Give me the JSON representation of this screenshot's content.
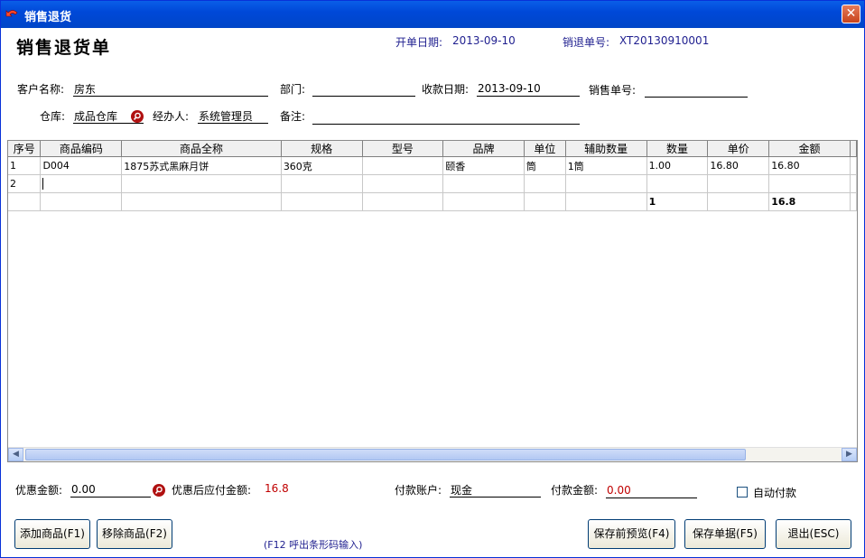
{
  "window": {
    "title": "销售退货",
    "close_glyph": "✕",
    "icon": "return-arrow-icon"
  },
  "header": {
    "form_title": "销售退货单",
    "open_date_label": "开单日期:",
    "open_date_value": "2013-09-10",
    "return_no_label": "销退单号:",
    "return_no_value": "XT20130910001"
  },
  "form": {
    "customer_label": "客户名称:",
    "customer_value": "房东",
    "dept_label": "部门:",
    "dept_value": "",
    "collect_date_label": "收款日期:",
    "collect_date_value": "2013-09-10",
    "sales_no_label": "销售单号:",
    "sales_no_value": "",
    "warehouse_label": "仓库:",
    "warehouse_value": "成品仓库",
    "handler_label": "经办人:",
    "handler_value": "系统管理员",
    "remark_label": "备注:",
    "remark_value": ""
  },
  "grid": {
    "columns": [
      "序号",
      "商品编码",
      "商品全称",
      "规格",
      "型号",
      "品牌",
      "单位",
      "辅助数量",
      "数量",
      "单价",
      "金额"
    ],
    "rows": [
      [
        "1",
        "D004",
        "1875苏式黑麻月饼",
        "360克",
        "",
        "颐香",
        "筒",
        "1筒",
        "1.00",
        "16.80",
        "16.80"
      ],
      [
        "2",
        "",
        "",
        "",
        "",
        "",
        "",
        "",
        "",
        "",
        ""
      ]
    ],
    "totals": [
      "",
      "",
      "",
      "",
      "",
      "",
      "",
      "",
      "1",
      "",
      "16.8"
    ]
  },
  "footer": {
    "discount_label": "优惠金额:",
    "discount_value": "0.00",
    "after_discount_label": "优惠后应付金额:",
    "after_discount_value": "16.8",
    "pay_account_label": "付款账户:",
    "pay_account_value": "现金",
    "pay_amount_label": "付款金额:",
    "pay_amount_value": "0.00",
    "auto_pay_label": "自动付款",
    "auto_pay_checked": false
  },
  "buttons": {
    "add": "添加商品(F1)",
    "remove": "移除商品(F2)",
    "barcode_hint": "(F12 呼出条形码输入)",
    "preview": "保存前预览(F4)",
    "save": "保存单据(F5)",
    "exit": "退出(ESC)"
  },
  "colors": {
    "accent_blue": "#1f1f8f",
    "amount_red": "#c00000",
    "titlebar": "#0054e3"
  }
}
